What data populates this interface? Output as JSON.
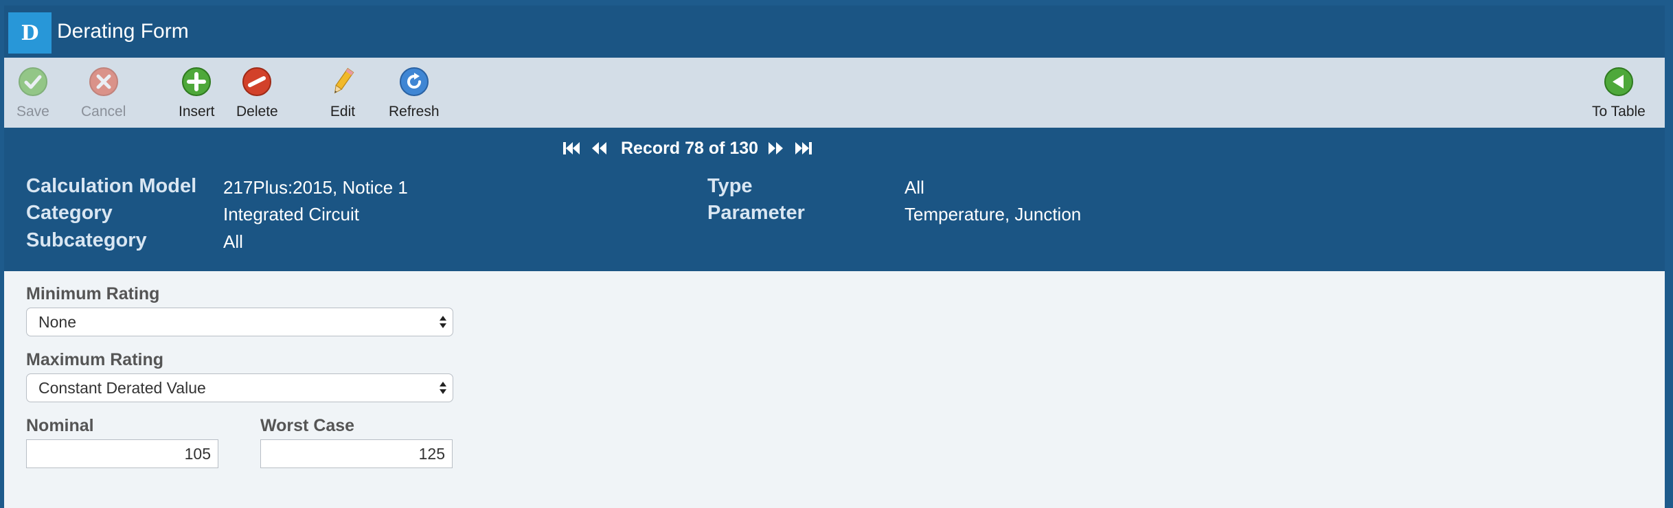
{
  "app": {
    "logo_letter": "D",
    "title": "Derating Form"
  },
  "toolbar": {
    "save": "Save",
    "cancel": "Cancel",
    "insert": "Insert",
    "delete": "Delete",
    "edit": "Edit",
    "refresh": "Refresh",
    "to_table": "To Table"
  },
  "navigation": {
    "record_text": "Record 78 of 130"
  },
  "header": {
    "calculation_model_label": "Calculation Model",
    "calculation_model_value": "217Plus:2015, Notice 1",
    "category_label": "Category",
    "category_value": "Integrated Circuit",
    "subcategory_label": "Subcategory",
    "subcategory_value": "All",
    "type_label": "Type",
    "type_value": "All",
    "parameter_label": "Parameter",
    "parameter_value": "Temperature, Junction"
  },
  "form": {
    "minimum_rating_label": "Minimum Rating",
    "minimum_rating_value": "None",
    "maximum_rating_label": "Maximum Rating",
    "maximum_rating_value": "Constant Derated Value",
    "nominal_label": "Nominal",
    "nominal_value": "105",
    "worst_case_label": "Worst Case",
    "worst_case_value": "125"
  },
  "colors": {
    "title_bar": "#1b5584",
    "toolbar": "#d3dde7",
    "logo": "#2897d8",
    "form_background": "#f0f4f7"
  }
}
